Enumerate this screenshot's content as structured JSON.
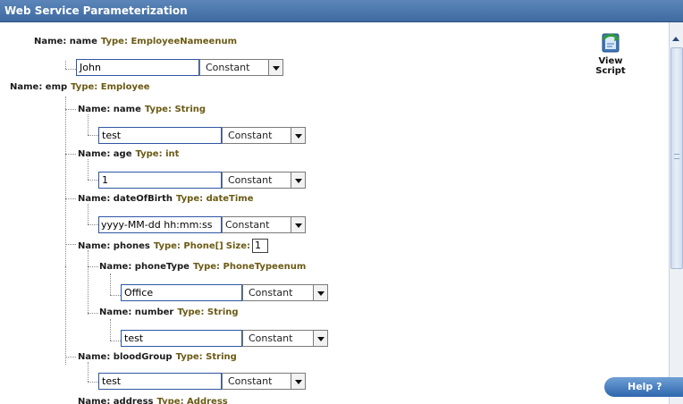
{
  "window": {
    "title": "Web Service Parameterization"
  },
  "view_script": {
    "label": "View Script",
    "icon": "script-scroll-icon"
  },
  "help": {
    "label": "Help ?"
  },
  "params": {
    "name": {
      "name_label": "Name: name",
      "type_label": "Type: EmployeeNameenum",
      "value": "John",
      "mode": "Constant"
    },
    "emp": {
      "name_label": "Name: emp",
      "type_label": "Type: Employee",
      "name": {
        "name_label": "Name: name",
        "type_label": "Type: String",
        "value": "test",
        "mode": "Constant"
      },
      "age": {
        "name_label": "Name: age",
        "type_label": "Type: int",
        "value": "1",
        "mode": "Constant"
      },
      "dob": {
        "name_label": "Name: dateOfBirth",
        "type_label": "Type: dateTime",
        "value": "yyyy-MM-dd hh:mm:ss",
        "mode": "Constant"
      },
      "phones": {
        "name_label": "Name: phones",
        "type_label": "Type: Phone[]",
        "size_label": "Size:",
        "size_value": "1",
        "phoneType": {
          "name_label": "Name: phoneType",
          "type_label": "Type: PhoneTypeenum",
          "value": "Office",
          "mode": "Constant"
        },
        "number": {
          "name_label": "Name: number",
          "type_label": "Type: String",
          "value": "test",
          "mode": "Constant"
        }
      },
      "bloodGroup": {
        "name_label": "Name: bloodGroup",
        "type_label": "Type: String",
        "value": "test",
        "mode": "Constant"
      },
      "address": {
        "name_label": "Name: address",
        "type_label": "Type: Address"
      }
    }
  },
  "colors": {
    "title_bar": "#4a76ad",
    "input_border": "#2f56a3",
    "type_text": "#6b5a14"
  }
}
